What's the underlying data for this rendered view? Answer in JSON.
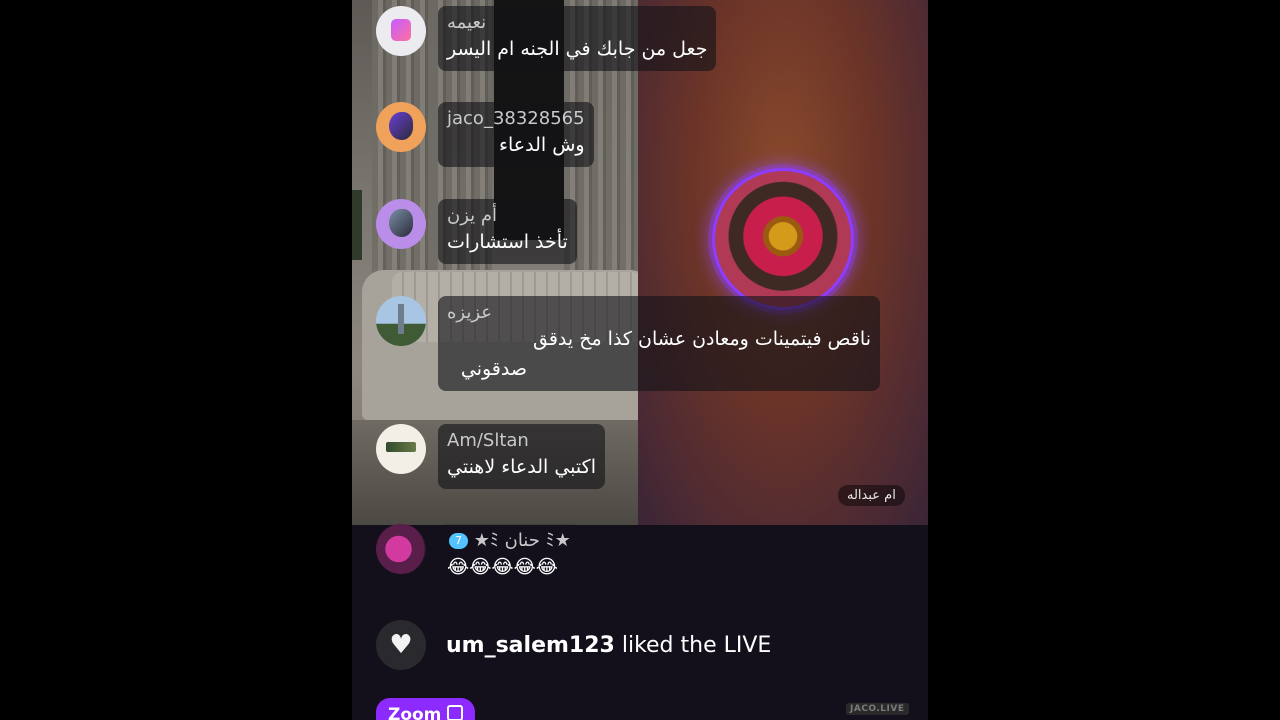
{
  "stream": {
    "host_name": "ام عبداله",
    "watermark": "JACO.LIVE"
  },
  "messages": [
    {
      "username": "نعيمه",
      "text": "جعل من جابك في الجنه ام اليسر"
    },
    {
      "username": "jaco_38328565",
      "text": "وش الدعاء"
    },
    {
      "username": "أم يزن",
      "text": "تأخذ استشارات"
    },
    {
      "username": "عزيزه",
      "text_line1": "ناقص فيتمينات ومعادن عشان كذا مخ يدقق",
      "text_line2": "صدقوني"
    },
    {
      "username": "Am/Sltan",
      "text": "اكتبي الدعاء لاهنتي"
    },
    {
      "username": "★ﾐ حنان ﾐ★",
      "badge": "7",
      "text": "😂😂😂😂😂"
    }
  ],
  "like_event": {
    "username": "um_salem123",
    "action": "liked the LIVE"
  },
  "zoom_button": {
    "label": "Zoom"
  },
  "colors": {
    "accent": "#8d2bff",
    "badge": "#53c4ff"
  },
  "icons": [
    "heart-icon",
    "zoom-icon"
  ]
}
